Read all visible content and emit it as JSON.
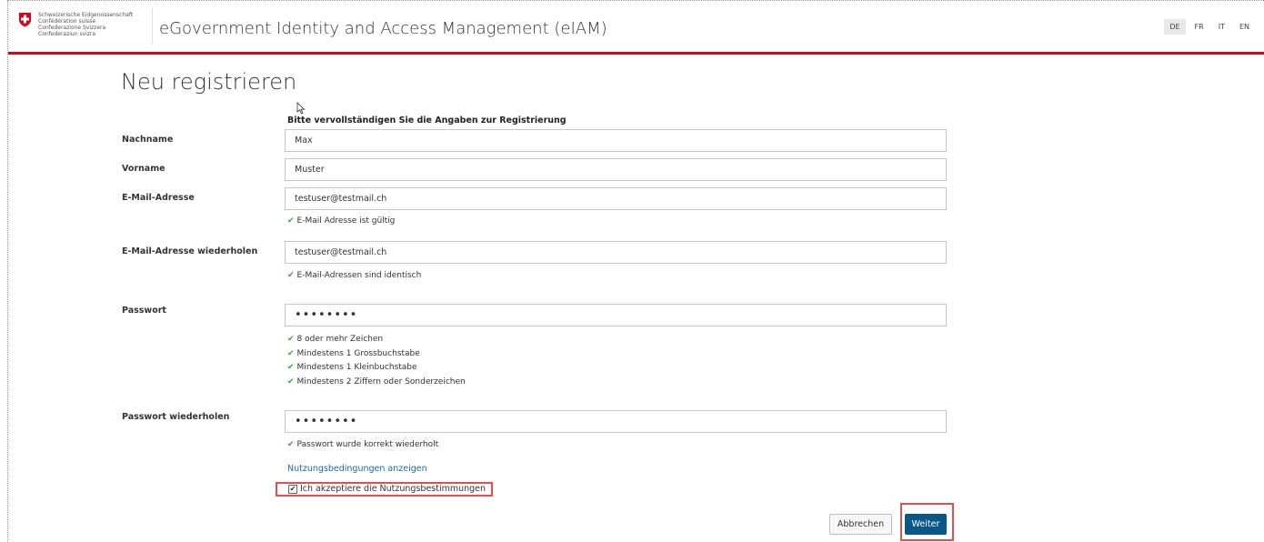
{
  "header": {
    "federation_lines": [
      "Schweizerische Eidgenossenschaft",
      "Confédération suisse",
      "Confederazione Svizzera",
      "Confederaziun svizra"
    ],
    "app_title": "eGovernment Identity and Access Management (eIAM)",
    "languages": [
      "DE",
      "FR",
      "IT",
      "EN"
    ],
    "active_language": "DE",
    "brand_color": "#dc0018"
  },
  "page": {
    "title": "Neu registrieren",
    "intro": "Bitte vervollständigen Sie die Angaben zur Registrierung"
  },
  "form": {
    "lastname": {
      "label": "Nachname",
      "value": "Max"
    },
    "firstname": {
      "label": "Vorname",
      "value": "Muster"
    },
    "email": {
      "label": "E-Mail-Adresse",
      "value": "testuser@testmail.ch",
      "message": "E-Mail Adresse ist gültig"
    },
    "email_repeat": {
      "label": "E-Mail-Adresse wiederholen",
      "value": "testuser@testmail.ch",
      "message": "E-Mail-Adressen sind identisch"
    },
    "password": {
      "label": "Passwort",
      "value": "••••••••",
      "rules": [
        "8 oder mehr Zeichen",
        "Mindestens 1 Grossbuchstabe",
        "Mindestens 1 Kleinbuchstabe",
        "Mindestens 2 Ziffern oder Sonderzeichen"
      ]
    },
    "password_repeat": {
      "label": "Passwort wiederholen",
      "value": "••••••••",
      "message": "Passwort wurde korrekt wiederholt"
    },
    "terms_link": "Nutzungsbedingungen anzeigen",
    "terms_accept": {
      "label": "Ich akzeptiere die Nutzungsbestimmungen",
      "checked": true
    },
    "check_color": "#3aa23a",
    "link_color": "#1f6aa8"
  },
  "actions": {
    "cancel": "Abbrechen",
    "next": "Weiter",
    "next_color": "#085788"
  }
}
